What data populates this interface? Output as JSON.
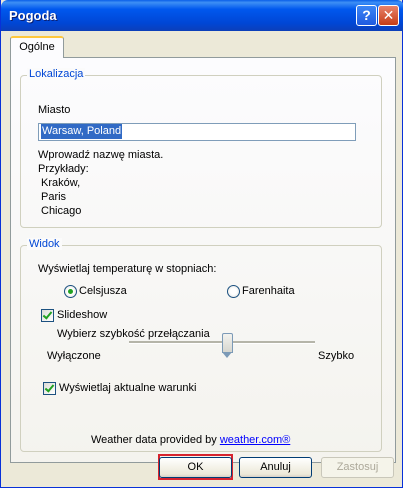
{
  "window": {
    "title": "Pogoda",
    "help_glyph": "?",
    "close_glyph": "✕"
  },
  "tabs": [
    {
      "label": "Ogólne",
      "active": true
    }
  ],
  "location": {
    "legend": "Lokalizacja",
    "city_label": "Miasto",
    "city_value": "Warsaw, Poland",
    "hint": "Wprowadź nazwę miasta.",
    "examples_label": "Przykłady:",
    "examples": [
      "Kraków,",
      "Paris",
      "Chicago"
    ]
  },
  "view": {
    "legend": "Widok",
    "temp_label": "Wyświetlaj temperaturę w stopniach:",
    "unit_options": [
      {
        "label": "Celsjusza",
        "selected": true
      },
      {
        "label": "Farenhaita",
        "selected": false
      }
    ],
    "slideshow_label": "Slideshow",
    "slideshow_checked": true,
    "speed_label": "Wybierz szybkość przełączania",
    "speed_min_label": "Wyłączone",
    "speed_max_label": "Szybko",
    "speed_value": 0.53,
    "current_conditions_label": "Wyświetlaj aktualne warunki",
    "current_conditions_checked": true,
    "credit_text": "Weather data provided by",
    "credit_link": "weather.com®"
  },
  "buttons": {
    "ok": "OK",
    "cancel": "Anuluj",
    "apply": "Zastosuj"
  },
  "colors": {
    "title_bar": "#0054e3",
    "legend_text": "#0046d5",
    "highlight": "#d6232e",
    "link": "#0000ff"
  }
}
